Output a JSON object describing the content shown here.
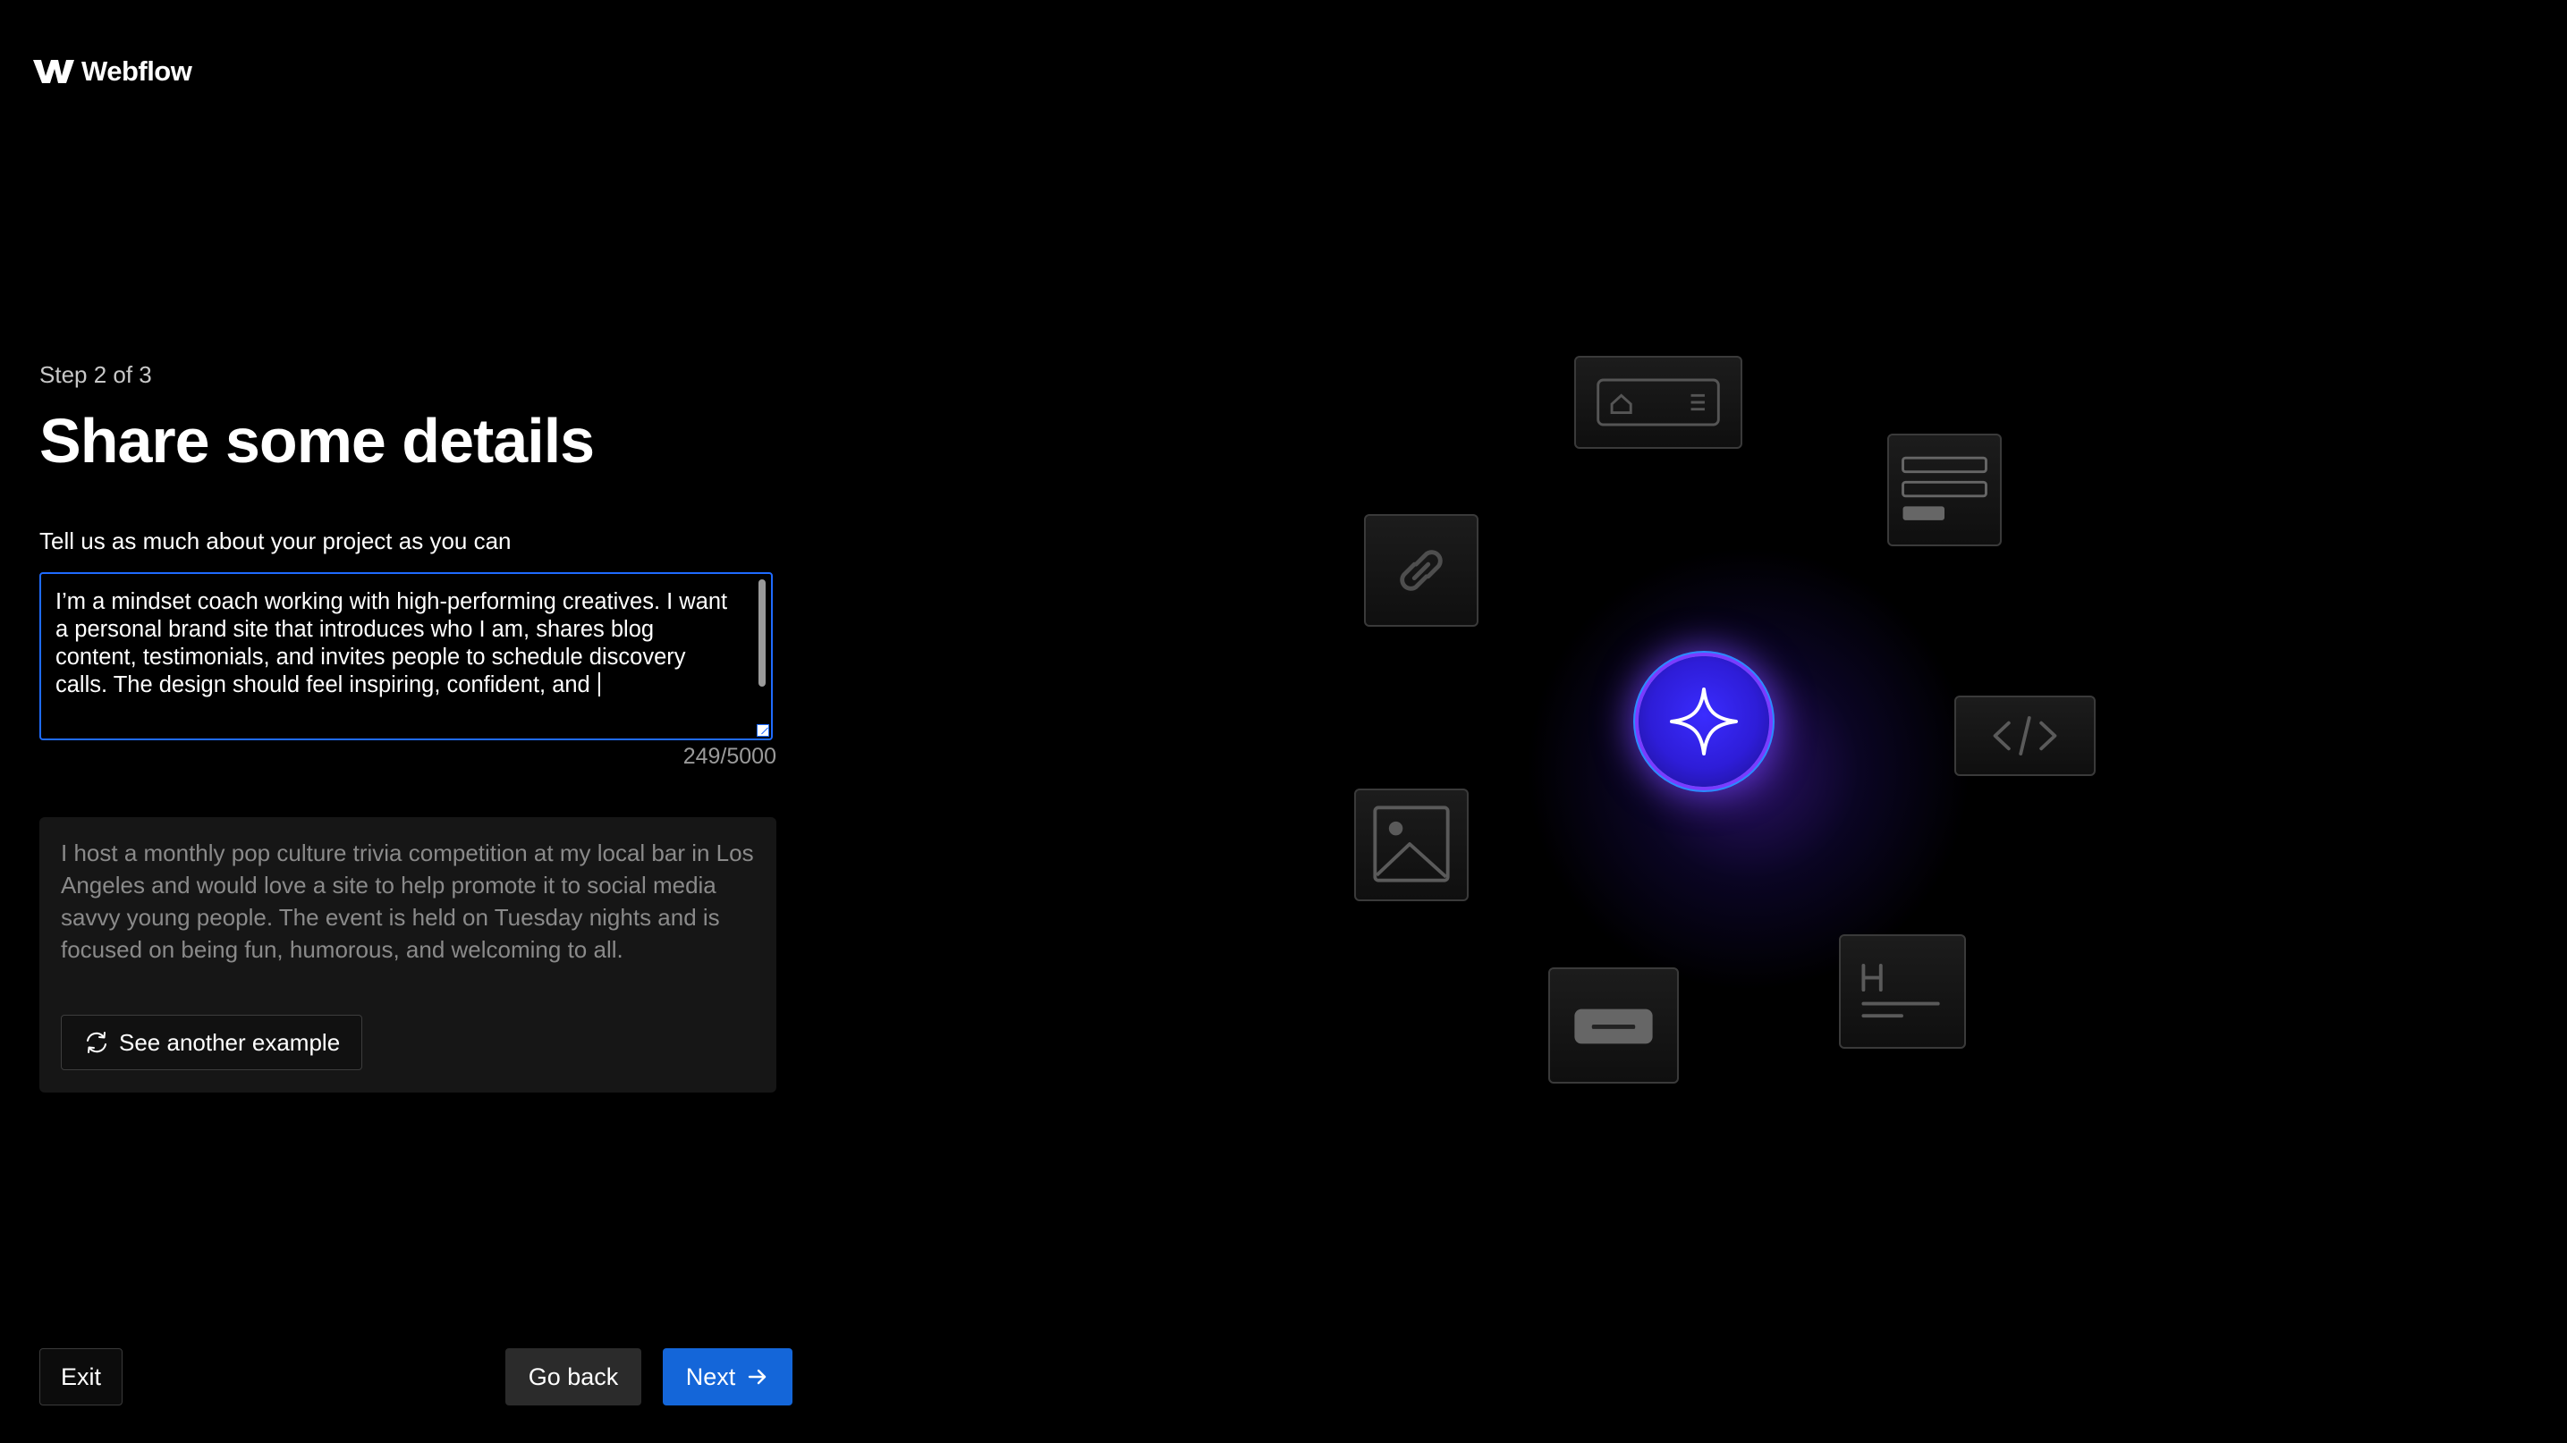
{
  "brand": {
    "name": "Webflow"
  },
  "step_label": "Step 2 of 3",
  "title": "Share some details",
  "prompt_label": "Tell us as much about your project as you can",
  "description": {
    "value": "I’m a mindset coach working with high-performing creatives. I want a personal brand site that introduces who I am, shares blog content, testimonials, and invites people to schedule discovery calls. The design should feel inspiring, confident, and ",
    "counter": "249/5000"
  },
  "example": {
    "text": "I host a monthly pop culture trivia competition at my local bar in Los Angeles and would love a site to help promote it to social media savvy young people. The event is held on Tuesday nights and is focused on being fun, humorous, and welcoming to all.",
    "button_label": "See another example"
  },
  "footer": {
    "exit_label": "Exit",
    "back_label": "Go back",
    "next_label": "Next"
  },
  "colors": {
    "accent": "#1466d9",
    "focus_border": "#1f6bff",
    "orb": "#3a2cff"
  },
  "icons": [
    "webflow-logo-icon",
    "refresh-icon",
    "arrow-right-icon",
    "sparkle-icon",
    "navbar-icon",
    "text-block-icon",
    "link-icon",
    "code-icon",
    "image-icon",
    "button-icon",
    "heading-icon"
  ]
}
